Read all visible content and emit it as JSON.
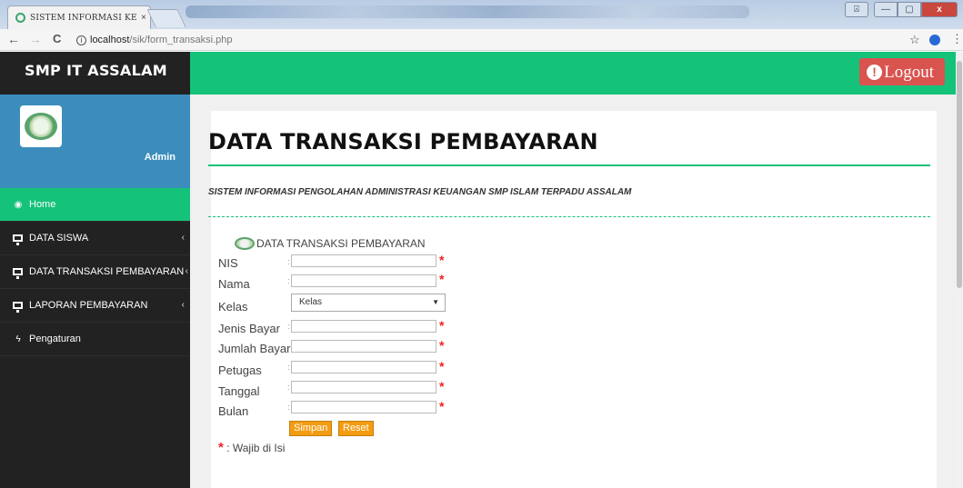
{
  "browser": {
    "tab_title": "SISTEM INFORMASI KEU",
    "tab_close": "×",
    "url_host": "localhost",
    "url_path": "/sik/form_transaksi.php",
    "back": "←",
    "forward": "→",
    "reload": "C",
    "info": "i",
    "star": "☆",
    "menu": "⋮",
    "win_min": "—",
    "win_max": "▢",
    "win_close": "x",
    "win_user": "⍓"
  },
  "sidebar": {
    "brand": "SMP IT ASSALAM",
    "user": "Admin",
    "items": [
      {
        "label": "Home",
        "icon": "dashboard-icon"
      },
      {
        "label": "DATA SISWA",
        "icon": "monitor-icon"
      },
      {
        "label": "DATA TRANSAKSI PEMBAYARAN",
        "icon": "monitor-icon"
      },
      {
        "label": "LAPORAN PEMBAYARAN",
        "icon": "monitor-icon"
      },
      {
        "label": "Pengaturan",
        "icon": "bolt-icon"
      }
    ],
    "chevron": "‹"
  },
  "header": {
    "logout_label": "Logout",
    "logout_icon": "!"
  },
  "main": {
    "title": "DATA TRANSAKSI PEMBAYARAN",
    "subtitle": "SISTEM INFORMASI PENGOLAHAN ADMINISTRASI KEUANGAN SMP ISLAM TERPADU ASSALAM",
    "form_heading": "DATA TRANSAKSI PEMBAYARAN",
    "fields": {
      "nis": "NIS",
      "nama": "Nama",
      "kelas": "Kelas",
      "jenis_bayar": "Jenis Bayar",
      "jumlah_bayar": "Jumlah Bayar",
      "petugas": "Petugas",
      "tanggal": "Tanggal",
      "bulan": "Bulan"
    },
    "colon": ":",
    "kelas_selected": "Kelas",
    "required_mark": "*",
    "save_label": "Simpan",
    "reset_label": "Reset",
    "note": ": Wajib di Isi"
  },
  "colors": {
    "accent_green": "#15c27a",
    "sidebar_dark": "#222222",
    "profile_blue": "#3c8dbc",
    "logout_red": "#d9534f",
    "button_orange": "#f39c12"
  }
}
